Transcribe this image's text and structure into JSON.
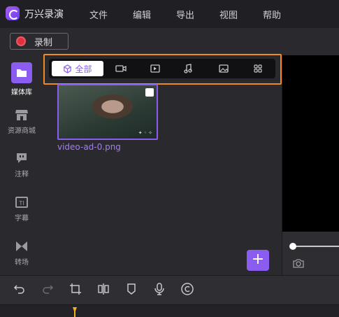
{
  "app": {
    "name": "万兴录演"
  },
  "menu": [
    "文件",
    "编辑",
    "导出",
    "视图",
    "帮助"
  ],
  "record": {
    "label": "录制"
  },
  "sidebar": {
    "items": [
      {
        "label": "媒体库",
        "icon": "folder-icon",
        "active": true
      },
      {
        "label": "资源商城",
        "icon": "store-icon",
        "active": false
      },
      {
        "label": "注释",
        "icon": "annotation-icon",
        "active": false
      },
      {
        "label": "字幕",
        "icon": "caption-icon",
        "active": false
      },
      {
        "label": "转场",
        "icon": "transition-icon",
        "active": false
      }
    ]
  },
  "filter": {
    "tabs": [
      {
        "label": "全部",
        "icon": "cube-icon",
        "active": true
      },
      {
        "label": "",
        "icon": "video-camera-icon",
        "active": false
      },
      {
        "label": "",
        "icon": "play-icon",
        "active": false
      },
      {
        "label": "",
        "icon": "music-note-icon",
        "active": false
      },
      {
        "label": "",
        "icon": "image-icon",
        "active": false
      },
      {
        "label": "",
        "icon": "grid-icon",
        "active": false
      }
    ]
  },
  "media": [
    {
      "filename": "video-ad-0.png",
      "type": "image"
    }
  ],
  "colors": {
    "accent": "#8a5cf0",
    "highlight_frame": "#f08a24",
    "record": "#e2303c",
    "playhead": "#f0b020"
  },
  "toolbar": {
    "tools": [
      "undo-icon",
      "redo-icon",
      "crop-icon",
      "split-icon",
      "marker-icon",
      "microphone-icon",
      "copyright-icon"
    ]
  }
}
